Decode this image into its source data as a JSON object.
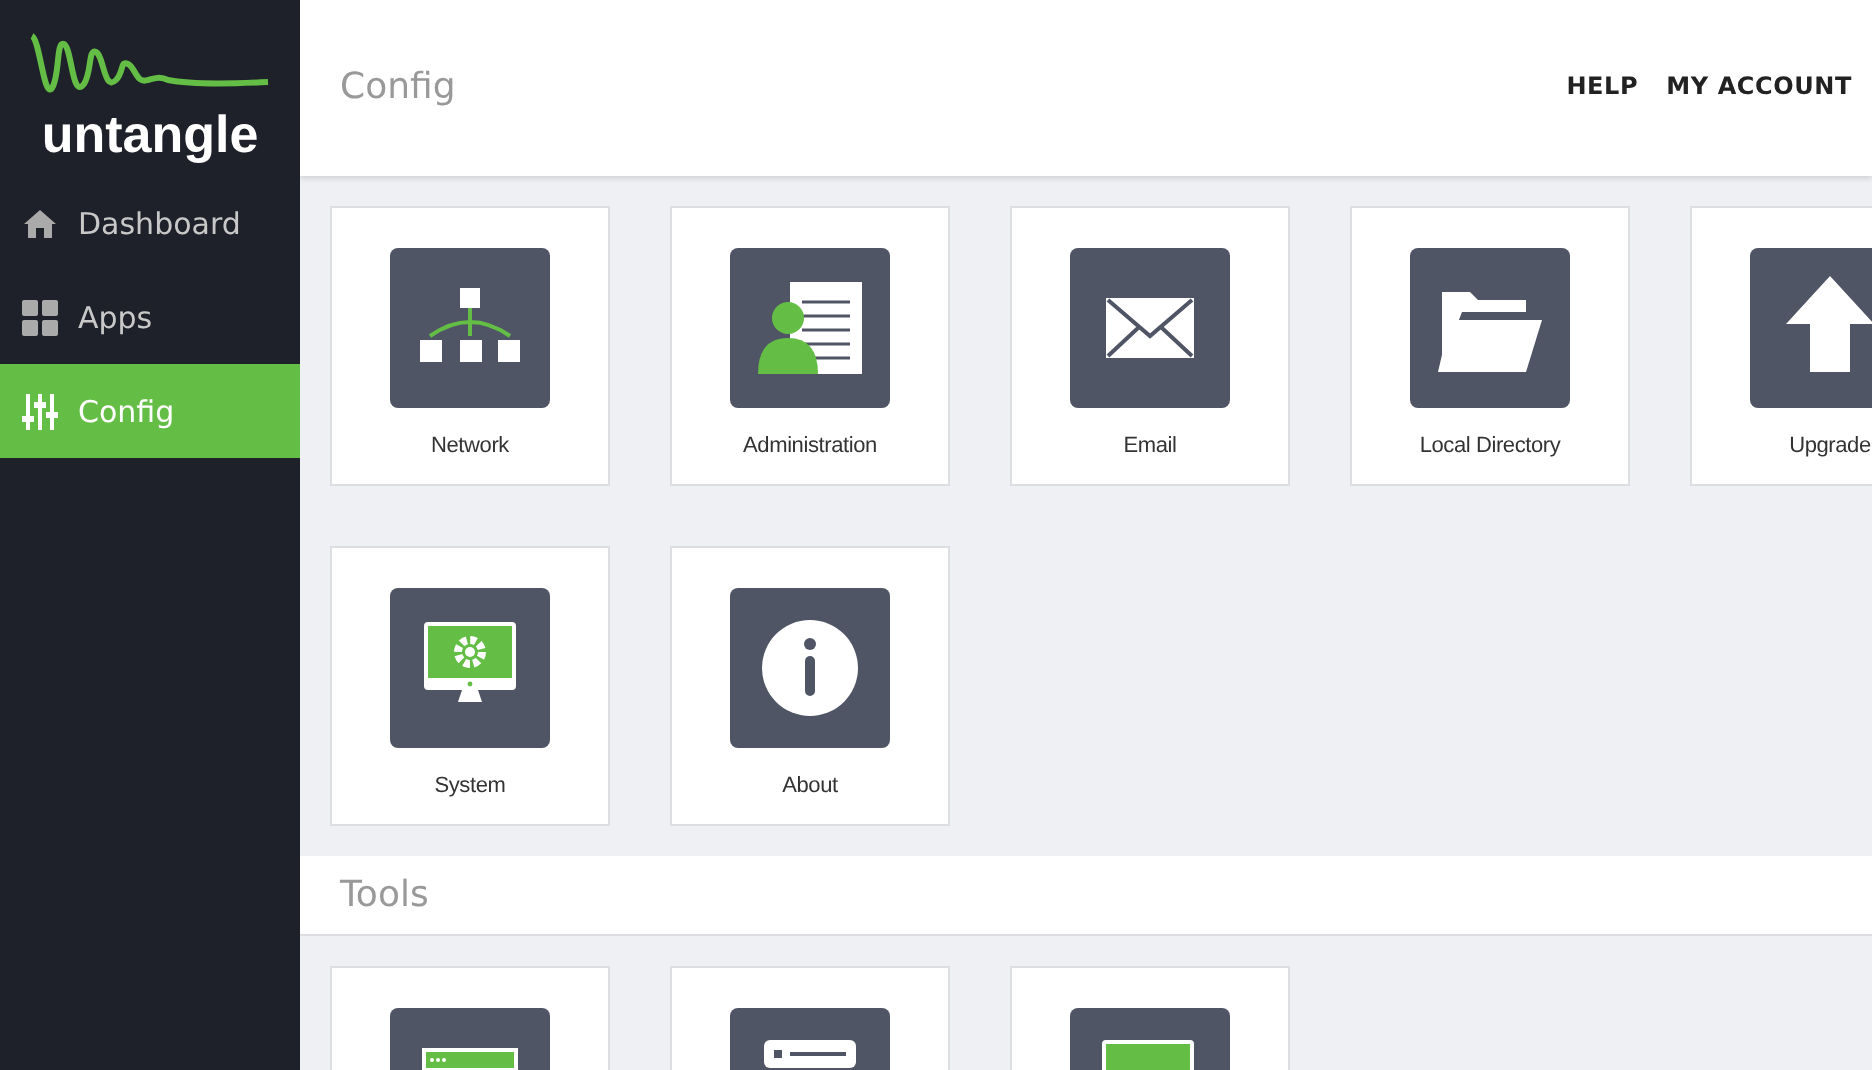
{
  "sidebar": {
    "logo": "untangle",
    "items": [
      {
        "label": "Dashboard",
        "kind": "home",
        "selected": false
      },
      {
        "label": "Apps",
        "kind": "grid",
        "selected": false
      },
      {
        "label": "Config",
        "kind": "sliders",
        "selected": true
      }
    ]
  },
  "header": {
    "title": "Config",
    "links": [
      "HELP",
      "MY ACCOUNT"
    ]
  },
  "config_rows": [
    [
      {
        "label": "Network",
        "kind": "network"
      },
      {
        "label": "Administration",
        "kind": "admin"
      },
      {
        "label": "Email",
        "kind": "email"
      },
      {
        "label": "Local Directory",
        "kind": "folder"
      },
      {
        "label": "Upgrade",
        "kind": "upgrade"
      }
    ],
    [
      {
        "label": "System",
        "kind": "system"
      },
      {
        "label": "About",
        "kind": "about"
      }
    ]
  ],
  "tools": {
    "title": "Tools",
    "tiles": [
      {
        "kind": "browser"
      },
      {
        "kind": "server"
      },
      {
        "kind": "screen"
      }
    ]
  }
}
